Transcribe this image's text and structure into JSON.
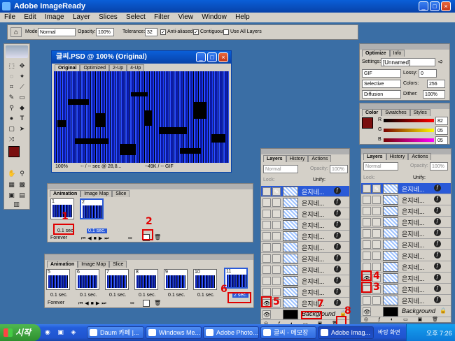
{
  "app": {
    "title": "Adobe ImageReady"
  },
  "menu": [
    "File",
    "Edit",
    "Image",
    "Layer",
    "Slices",
    "Select",
    "Filter",
    "View",
    "Window",
    "Help"
  ],
  "options_bar": {
    "mode_label": "Mode:",
    "mode_value": "Normal",
    "opacity_label": "Opacity:",
    "opacity_value": "100%",
    "tolerance_label": "Tolerance:",
    "tolerance_value": "32",
    "anti_aliased": "Anti-aliased",
    "contiguous": "Contiguous",
    "use_all_layers": "Use All Layers"
  },
  "document": {
    "title": "글씨.PSD @ 100% (Original)",
    "tabs": [
      "Original",
      "Optimized",
      "2-Up",
      "4-Up"
    ],
    "status_zoom": "100%",
    "status_time": "-- / -- sec @ 28,8...",
    "status_size": "~49K / -- GIF"
  },
  "optimize": {
    "tabs": [
      "Optimize",
      "Info"
    ],
    "settings_label": "Settings:",
    "settings_value": "[Unnamed]",
    "format": "GIF",
    "lossy_label": "Lossy:",
    "lossy_value": "0",
    "reduction": "Selective",
    "colors_label": "Colors:",
    "colors_value": "256",
    "dither_algo": "Diffusion",
    "dither_label": "Dither:",
    "dither_value": "100%"
  },
  "color": {
    "tabs": [
      "Color",
      "Swatches",
      "Styles"
    ],
    "r_label": "R",
    "r_value": "82",
    "g_label": "G",
    "g_value": "05",
    "b_label": "B",
    "b_value": "05"
  },
  "animation_top": {
    "tabs": [
      "Animation",
      "Image Map",
      "Slice"
    ],
    "frames": [
      {
        "num": "1",
        "delay": "0.1 sec."
      },
      {
        "num": "2",
        "delay": "0.1 sec."
      }
    ],
    "loop": "Forever"
  },
  "animation_bottom": {
    "tabs": [
      "Animation",
      "Image Map",
      "Slice"
    ],
    "frames": [
      {
        "num": "5",
        "delay": "0.1 sec."
      },
      {
        "num": "6",
        "delay": "0.1 sec."
      },
      {
        "num": "7",
        "delay": "0.1 sec."
      },
      {
        "num": "8",
        "delay": "0.1 sec."
      },
      {
        "num": "9",
        "delay": "0.1 sec."
      },
      {
        "num": "10",
        "delay": "0.1 sec."
      },
      {
        "num": "11",
        "delay": "2 sec."
      }
    ],
    "loop": "Forever"
  },
  "layers_mid": {
    "tabs": [
      "Layers",
      "History",
      "Actions"
    ],
    "blend": "Normal",
    "opacity_label": "Opacity:",
    "opacity_value": "100%",
    "lock_label": "Lock:",
    "unify_label": "Unify:",
    "layer_name": "은지네...",
    "background": "Background"
  },
  "layers_right": {
    "tabs": [
      "Layers",
      "History",
      "Actions"
    ],
    "blend": "Normal",
    "opacity_label": "Opacity:",
    "opacity_value": "100%",
    "lock_label": "Lock:",
    "unify_label": "Unify:",
    "layer_name": "은지네...",
    "background": "Background"
  },
  "annotations": [
    "1",
    "2",
    "3",
    "4",
    "5",
    "6",
    "7",
    "8"
  ],
  "taskbar": {
    "start": "시작",
    "tasks": [
      "Daum 카페 |...",
      "Windows Me...",
      "Adobe Photo...",
      "글씨 - 메모장",
      "Adobe Imag..."
    ],
    "desktop": "바탕 화면",
    "time": "오후 7:26"
  }
}
